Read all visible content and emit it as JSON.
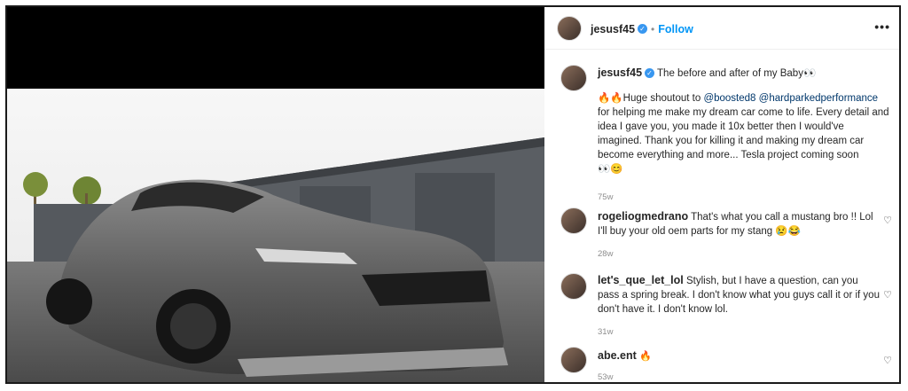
{
  "post": {
    "username": "jesusf45",
    "follow_label": "Follow",
    "separator": "•",
    "more_label": "•••",
    "caption_title": "The before and after of my Baby👀",
    "caption_prefix": "🔥🔥Huge shoutout to ",
    "mention1": "@boosted8",
    "mention2": "@hardparkedperformance",
    "caption_body": " for helping me make my dream car come to life. Every detail and idea I gave you, you made it 10x better then I would've imagined. Thank you for killing it and making my dream car become everything and more... Tesla project coming soon",
    "caption_emojis": "👀😊",
    "caption_time": "75w"
  },
  "comments": [
    {
      "username": "rogeliogmedrano",
      "text": "That's what you call a mustang bro !! Lol I'll buy your old oem parts for my stang 😢😂",
      "time": "28w"
    },
    {
      "username": "let's_que_let_lol",
      "text": "Stylish, but I have a question, can you pass a spring break. I don't know what you guys call it or if you don't have it. I don't know lol.",
      "time": "31w"
    },
    {
      "username": "abe.ent",
      "text": "🔥",
      "time": "53w"
    }
  ],
  "icons": {
    "heart": "heart-icon",
    "verified": "verified-badge-icon",
    "more": "more-options-icon"
  }
}
